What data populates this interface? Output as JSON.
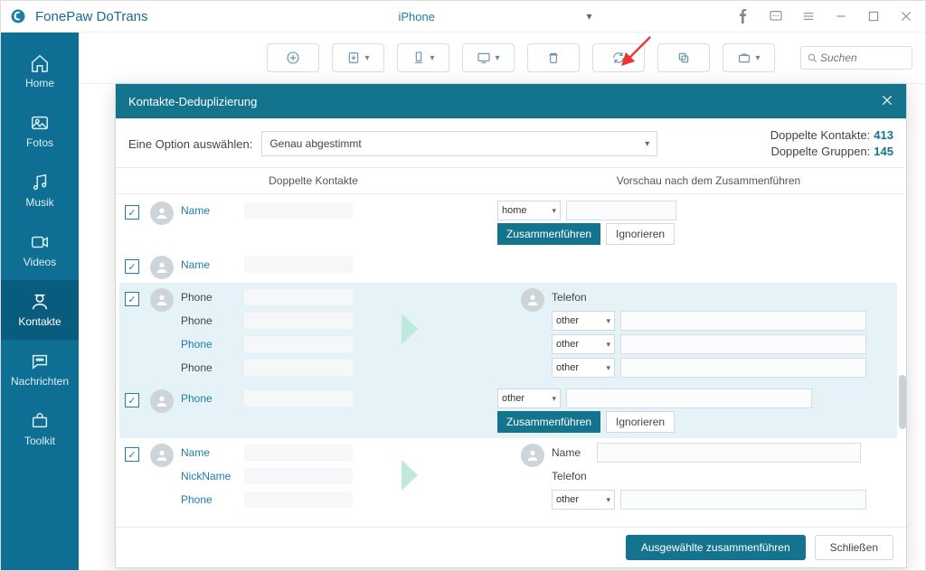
{
  "app": {
    "title": "FonePaw DoTrans"
  },
  "device": {
    "name": "iPhone"
  },
  "search": {
    "placeholder": "Suchen"
  },
  "sidebar": {
    "items": [
      {
        "label": "Home",
        "icon": "home"
      },
      {
        "label": "Fotos",
        "icon": "photo"
      },
      {
        "label": "Musik",
        "icon": "music"
      },
      {
        "label": "Videos",
        "icon": "video"
      },
      {
        "label": "Kontakte",
        "icon": "contacts"
      },
      {
        "label": "Nachrichten",
        "icon": "message"
      },
      {
        "label": "Toolkit",
        "icon": "toolkit"
      }
    ],
    "active_index": 4
  },
  "modal": {
    "title": "Kontakte-Deduplizierung",
    "option_label": "Eine Option auswählen:",
    "option_value": "Genau abgestimmt",
    "stats": {
      "dup_contacts_label": "Doppelte Kontakte:",
      "dup_contacts_value": "413",
      "dup_groups_label": "Doppelte Gruppen:",
      "dup_groups_value": "145"
    },
    "columns": {
      "left": "Doppelte Kontakte",
      "right": "Vorschau nach dem Zusammenführen"
    },
    "labels": {
      "name": "Name",
      "nickname": "NickName",
      "phone": "Phone",
      "telefon": "Telefon",
      "home": "home",
      "other": "other"
    },
    "actions": {
      "merge": "Zusammenführen",
      "ignore": "Ignorieren"
    },
    "footer": {
      "merge_selected": "Ausgewählte zusammenführen",
      "close": "Schließen"
    }
  }
}
